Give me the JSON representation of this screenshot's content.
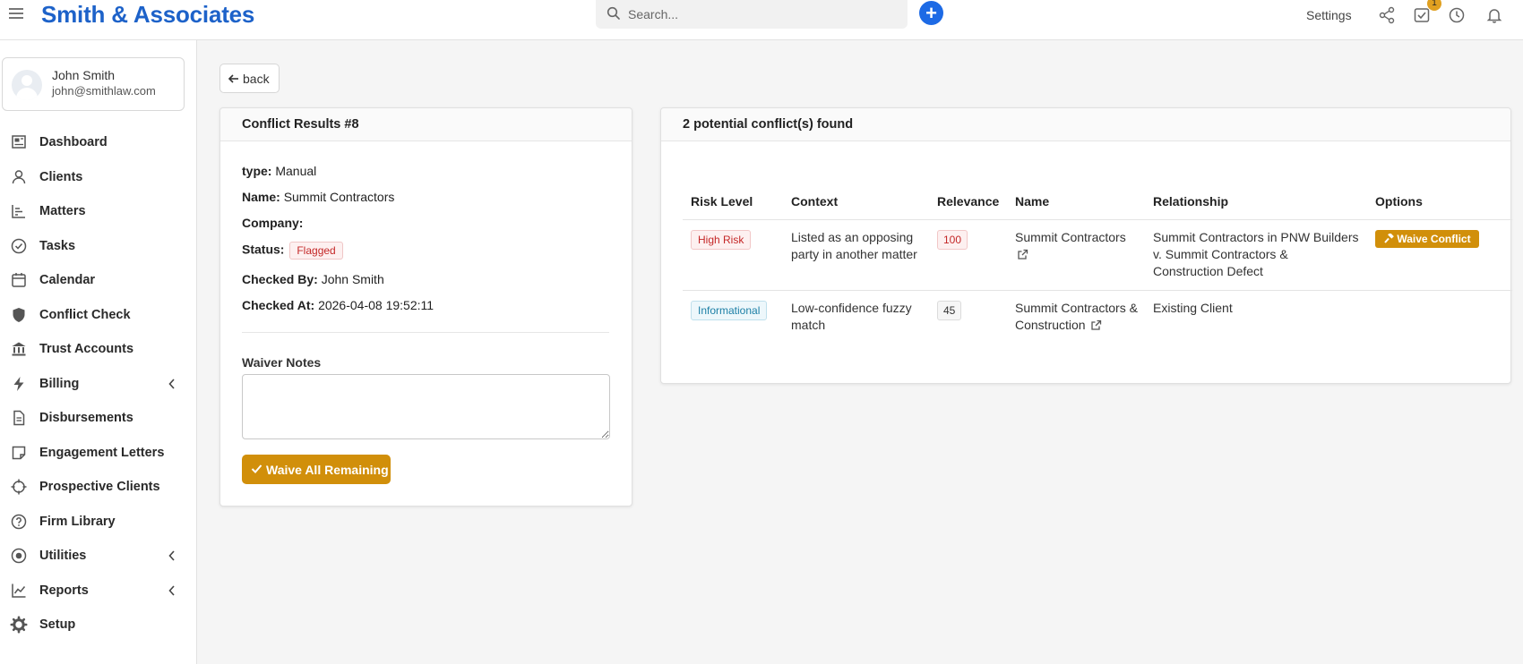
{
  "app": {
    "brand": "Smith & Associates"
  },
  "topbar": {
    "search_placeholder": "Search...",
    "settings_label": "Settings",
    "tasks_badge": "1"
  },
  "user": {
    "name": "John Smith",
    "email": "john@smithlaw.com"
  },
  "sidebar": {
    "items": [
      {
        "label": "Dashboard"
      },
      {
        "label": "Clients"
      },
      {
        "label": "Matters"
      },
      {
        "label": "Tasks"
      },
      {
        "label": "Calendar"
      },
      {
        "label": "Conflict Check"
      },
      {
        "label": "Trust Accounts"
      },
      {
        "label": "Billing"
      },
      {
        "label": "Disbursements"
      },
      {
        "label": "Engagement Letters"
      },
      {
        "label": "Prospective Clients"
      },
      {
        "label": "Firm Library"
      },
      {
        "label": "Utilities"
      },
      {
        "label": "Reports"
      },
      {
        "label": "Setup"
      }
    ]
  },
  "back_label": "back",
  "results": {
    "title": "Conflict Results #8",
    "type_key": "type:",
    "type_value": "Manual",
    "name_key": "Name:",
    "name_value": "Summit Contractors",
    "company_key": "Company:",
    "company_value": "",
    "status_key": "Status:",
    "status_value": "Flagged",
    "checked_by_key": "Checked By:",
    "checked_by_value": "John Smith",
    "checked_at_key": "Checked At:",
    "checked_at_value": "2026-04-08 19:52:11",
    "waiver_notes_label": "Waiver Notes",
    "waive_all_label": "Waive All Remaining"
  },
  "conflicts": {
    "title": "2 potential conflict(s) found",
    "headers": {
      "risk": "Risk Level",
      "context": "Context",
      "relevance": "Relevance",
      "name": "Name",
      "relationship": "Relationship",
      "options": "Options"
    },
    "rows": [
      {
        "risk": "High Risk",
        "context": "Listed as an opposing party in another matter",
        "relevance": "100",
        "name": "Summit Contractors",
        "relationship": "Summit Contractors in PNW Builders v. Summit Contractors & Construction Defect",
        "option": "Waive Conflict"
      },
      {
        "risk": "Informational",
        "context": "Low-confidence fuzzy match",
        "relevance": "45",
        "name": "Summit Contractors & Construction",
        "relationship": "Existing Client",
        "option": ""
      }
    ]
  }
}
